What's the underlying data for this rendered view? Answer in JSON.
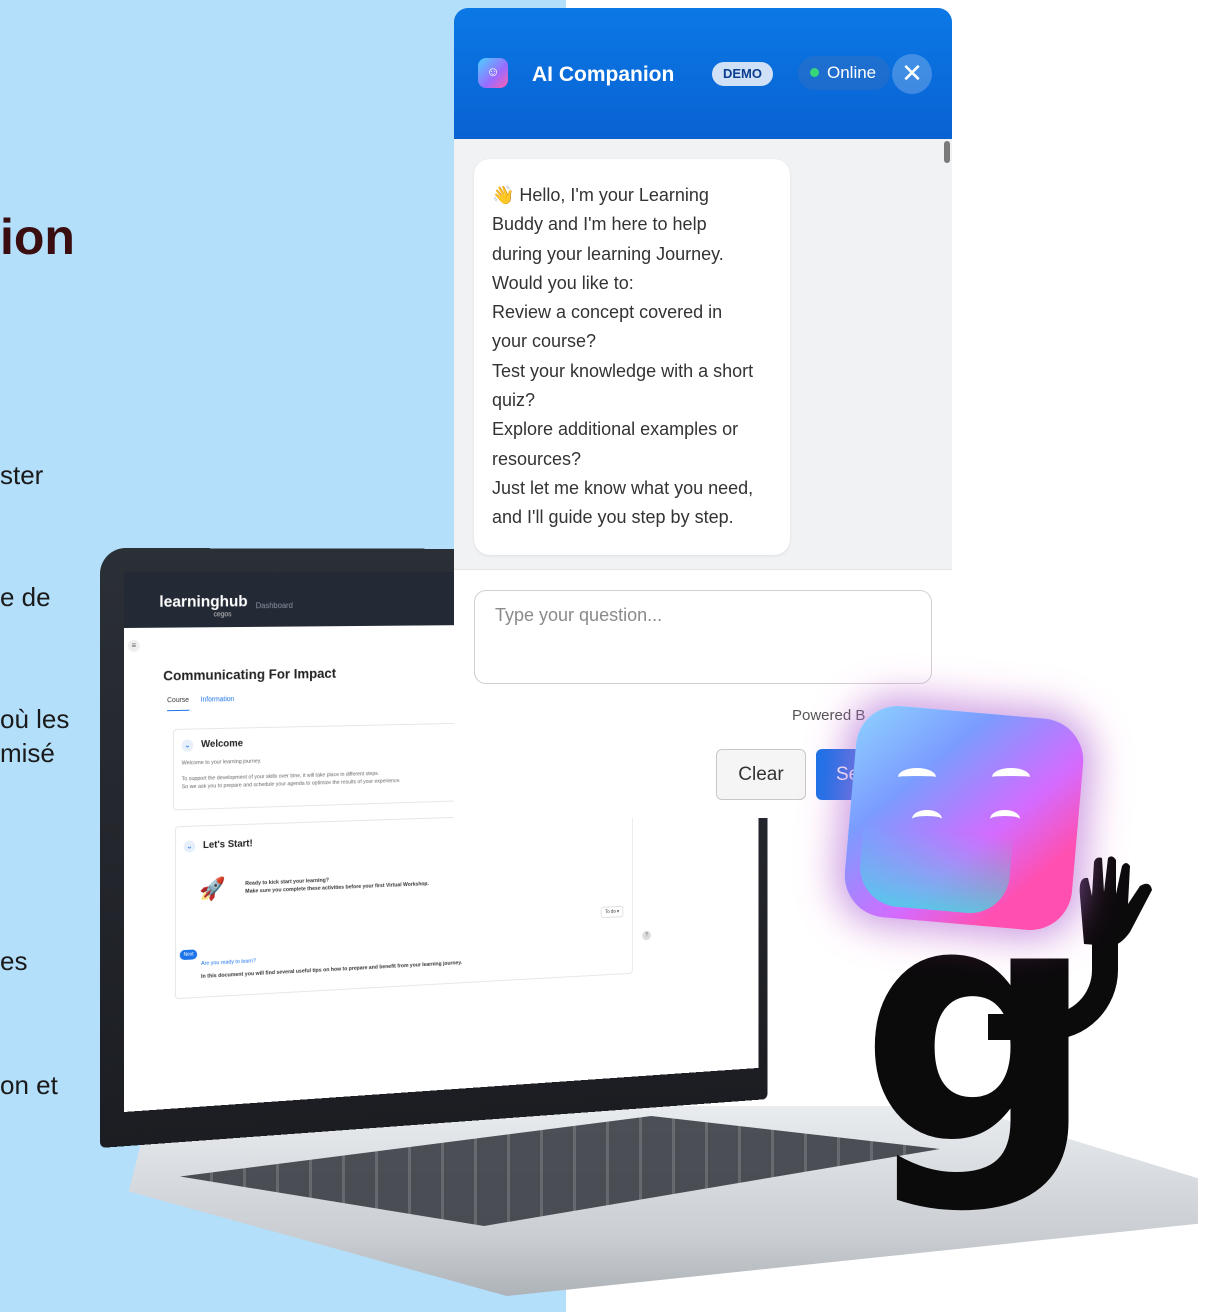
{
  "slide": {
    "title_fragment": "ion",
    "text_fragments": [
      "ster",
      "e de",
      "où les",
      "misé",
      "es",
      "on et"
    ]
  },
  "learninghub": {
    "logo": "learninghub",
    "logo_sub": "cegos",
    "nav_dashboard": "Dashboard",
    "menu_glyph": "≡",
    "course_title": "Communicating For Impact",
    "tabs": [
      {
        "label": "Course"
      },
      {
        "label": "Information"
      }
    ],
    "chevron_glyph": "⌄",
    "welcome": {
      "title": "Welcome",
      "intro": "Welcome to your learning journey.",
      "line1": "To support the development of your skills over time, it will take place in different steps.",
      "line2": "So we ask you to prepare and schedule your agenda to optimize the results of your experience."
    },
    "lets_start": {
      "title": "Let's Start!",
      "rocket_glyph": "🚀",
      "line1": "Ready to kick start your learning?",
      "line2": "Make sure you complete these activities before your first Virtual Workshop.",
      "todo_label": "To do ▾",
      "help_glyph": "?",
      "next_badge": "Next",
      "activity_title": "Are you ready to learn?",
      "activity_desc": "In this document you will find several useful tips on how to prepare and benefit from your learning journey."
    }
  },
  "chat": {
    "bot_icon": "robot-face-icon",
    "bot_glyph": "☺",
    "title": "AI Companion",
    "demo_badge": "DEMO",
    "status": "Online",
    "close_glyph": "✕",
    "message_lines": [
      "👋 Hello, I'm your Learning",
      "Buddy and I'm here to help",
      "during your learning Journey.",
      "Would you like to:",
      "Review a concept covered in",
      "your course?",
      "Test your knowledge with a short",
      "quiz?",
      "Explore additional examples or",
      "resources?",
      "Just let me know what you need,",
      "and I'll guide you step by step."
    ],
    "input_placeholder": "Type your question...",
    "powered_by": "Powered B",
    "clear_label": "Clear",
    "send_label": "Se"
  },
  "mascot": {
    "letter": "g"
  },
  "colors": {
    "left_panel": "#b3dffb",
    "chat_header": "#0a6ddc",
    "send_button": "#1a73e8",
    "online_dot": "#37d67a"
  }
}
